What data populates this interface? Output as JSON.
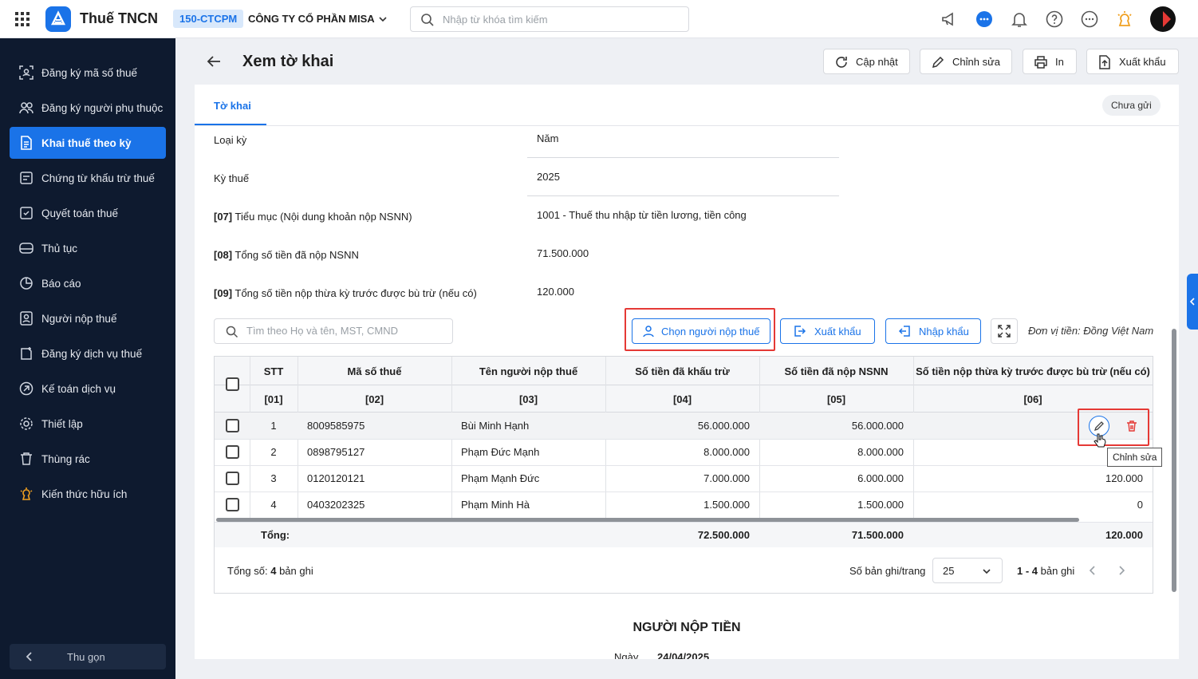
{
  "header": {
    "app_title": "Thuế TNCN",
    "company_code": "150-CTCPM",
    "company_name": "CÔNG TY CỔ PHẦN MISA",
    "search_placeholder": "Nhập từ khóa tìm kiếm",
    "icons": [
      "apps-grid-icon",
      "megaphone-icon",
      "chat-icon",
      "bell-icon",
      "help-icon",
      "more-icon",
      "idea-icon",
      "avatar"
    ]
  },
  "sidebar": {
    "items": [
      {
        "label": "Đăng ký mã số thuế",
        "icon": "id-scan-icon"
      },
      {
        "label": "Đăng ký người phụ thuộc",
        "icon": "people-icon"
      },
      {
        "label": "Khai thuế theo kỳ",
        "icon": "document-icon",
        "active": true
      },
      {
        "label": "Chứng từ khấu trừ thuế",
        "icon": "receipt-icon"
      },
      {
        "label": "Quyết toán thuế",
        "icon": "settlement-icon"
      },
      {
        "label": "Thủ tục",
        "icon": "procedure-icon"
      },
      {
        "label": "Báo cáo",
        "icon": "report-icon"
      },
      {
        "label": "Người nộp thuế",
        "icon": "taxpayer-icon"
      },
      {
        "label": "Đăng ký dịch vụ thuế",
        "icon": "service-icon"
      },
      {
        "label": "Kế toán dịch vụ",
        "icon": "accounting-icon"
      },
      {
        "label": "Thiết lập",
        "icon": "settings-icon"
      },
      {
        "label": "Thùng rác",
        "icon": "trash-icon"
      },
      {
        "label": "Kiến thức hữu ích",
        "icon": "knowledge-icon"
      }
    ],
    "collapse_label": "Thu gọn"
  },
  "page": {
    "title": "Xem tờ khai",
    "buttons": {
      "refresh": "Cập nhật",
      "edit": "Chỉnh sửa",
      "print": "In",
      "export": "Xuất khẩu"
    },
    "tab": "Tờ khai",
    "status": "Chưa gửi"
  },
  "fields": [
    {
      "label": "Loại kỳ",
      "value": "Năm"
    },
    {
      "label": "Kỳ thuế",
      "value": "2025"
    },
    {
      "code": "[07]",
      "label": "Tiểu mục (Nội dung khoản nộp NSNN)",
      "value": "1001 - Thuế thu nhập từ tiền lương, tiền công"
    },
    {
      "code": "[08]",
      "label": "Tổng số tiền đã nộp NSNN",
      "value": "71.500.000"
    },
    {
      "code": "[09]",
      "label": "Tổng số tiền nộp thừa kỳ trước được bù trừ (nếu có)",
      "value": "120.000"
    }
  ],
  "toolbar": {
    "search_placeholder": "Tìm theo Họ và tên, MST, CMND",
    "choose_taxpayer": "Chọn người nộp thuế",
    "export": "Xuất khẩu",
    "import": "Nhập khẩu",
    "unit": "Đơn vị tiền: Đồng Việt Nam"
  },
  "table": {
    "headers": [
      "STT",
      "Mã số thuế",
      "Tên người nộp thuế",
      "Số tiền đã khấu trừ",
      "Số tiền đã nộp NSNN",
      "Số tiền nộp thừa kỳ trước được bù trừ (nếu có)"
    ],
    "codes": [
      "[01]",
      "[02]",
      "[03]",
      "[04]",
      "[05]",
      "[06]"
    ],
    "rows": [
      {
        "stt": "1",
        "mst": "8009585975",
        "name": "Bùi Minh Hạnh",
        "withheld": "56.000.000",
        "paid": "56.000.000",
        "offset": ""
      },
      {
        "stt": "2",
        "mst": "0898795127",
        "name": "Phạm Đức Mạnh",
        "withheld": "8.000.000",
        "paid": "8.000.000",
        "offset": ""
      },
      {
        "stt": "3",
        "mst": "0120120121",
        "name": "Phạm Mạnh Đức",
        "withheld": "7.000.000",
        "paid": "6.000.000",
        "offset": "120.000"
      },
      {
        "stt": "4",
        "mst": "0403202325",
        "name": "Phạm Minh Hà",
        "withheld": "1.500.000",
        "paid": "1.500.000",
        "offset": "0"
      }
    ],
    "total_label": "Tổng:",
    "totals": {
      "withheld": "72.500.000",
      "paid": "71.500.000",
      "offset": "120.000"
    },
    "tooltip": "Chỉnh sửa"
  },
  "pager": {
    "total_prefix": "Tổng số:",
    "total_count": "4",
    "total_suffix": "bản ghi",
    "per_page_label": "Số bản ghi/trang",
    "per_page": "25",
    "range": "1 - 4",
    "range_suffix": "bản ghi"
  },
  "signature": {
    "title": "NGƯỜI NỘP TIỀN",
    "date_label": "Ngày",
    "date": "24/04/2025"
  },
  "colors": {
    "primary": "#1a73e8",
    "sidebar": "#0e1a2f",
    "highlight": "#e53935"
  }
}
